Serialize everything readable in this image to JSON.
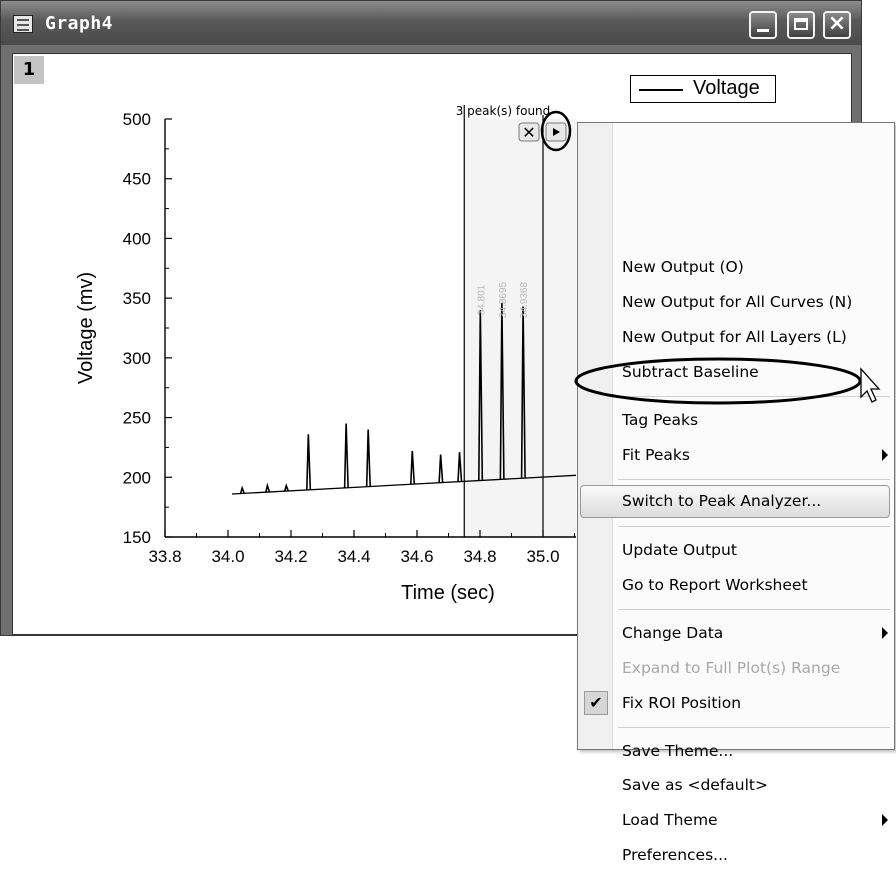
{
  "window": {
    "title": "Graph4",
    "layer_number": "1"
  },
  "legend": {
    "label": "Voltage"
  },
  "roi": {
    "status": "3 peak(s) found"
  },
  "chart_data": {
    "type": "line",
    "xlabel": "Time (sec)",
    "ylabel": "Voltage (mv)",
    "xlim": [
      33.8,
      35.2
    ],
    "ylim": [
      150,
      500
    ],
    "x_ticks": [
      "33.8",
      "34.0",
      "34.2",
      "34.4",
      "34.6",
      "34.8",
      "35.0"
    ],
    "y_ticks": [
      "500",
      "450",
      "400",
      "350",
      "300",
      "250",
      "200",
      "150"
    ],
    "series": [
      {
        "name": "Voltage",
        "baseline": {
          "x": [
            34.0,
            35.2
          ],
          "y": [
            186,
            203
          ]
        },
        "peaks": [
          {
            "x": 34.045,
            "y": 191
          },
          {
            "x": 34.125,
            "y": 193
          },
          {
            "x": 34.185,
            "y": 193
          },
          {
            "x": 34.255,
            "y": 236
          },
          {
            "x": 34.375,
            "y": 245
          },
          {
            "x": 34.445,
            "y": 240
          },
          {
            "x": 34.585,
            "y": 222
          },
          {
            "x": 34.675,
            "y": 219
          },
          {
            "x": 34.735,
            "y": 221
          },
          {
            "x": 34.801,
            "y": 340
          },
          {
            "x": 34.8695,
            "y": 346
          },
          {
            "x": 34.9368,
            "y": 343
          }
        ]
      }
    ],
    "roi_range": [
      34.75,
      35.0
    ],
    "peak_labels": [
      {
        "x": 34.801,
        "text": "34.801"
      },
      {
        "x": 34.8695,
        "text": "34.8695"
      },
      {
        "x": 34.9368,
        "text": "34.9368"
      }
    ]
  },
  "menu": {
    "items": [
      {
        "label": "New Output (O)"
      },
      {
        "label": "New Output for All Curves (N)"
      },
      {
        "label": "New Output for All Layers (L)"
      },
      {
        "label": "Subtract Baseline"
      },
      {
        "label": "Tag Peaks"
      },
      {
        "label": "Fit Peaks"
      },
      {
        "label": "Switch to Peak Analyzer..."
      },
      {
        "label": "Update Output"
      },
      {
        "label": "Go to Report Worksheet"
      },
      {
        "label": "Change Data"
      },
      {
        "label": "Expand to Full Plot(s) Range"
      },
      {
        "label": "Fix ROI Position"
      },
      {
        "label": "Save Theme..."
      },
      {
        "label": "Save as <default>"
      },
      {
        "label": "Load Theme"
      },
      {
        "label": "Preferences..."
      }
    ]
  }
}
